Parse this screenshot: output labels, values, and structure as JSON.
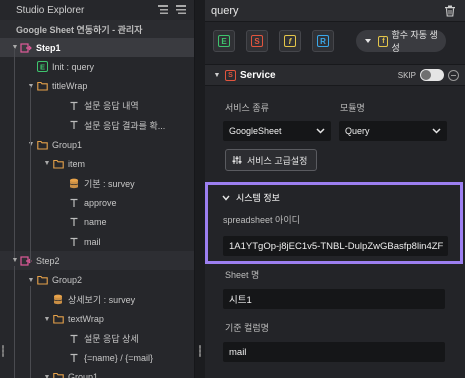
{
  "explorer": {
    "title": "Studio Explorer",
    "subtitle": "Google Sheet 연동하기 - 관리자",
    "tree": [
      {
        "label": "Step1",
        "icon": "step-icon",
        "level": 0,
        "caret": "▼",
        "selected": true
      },
      {
        "label": "Init : query",
        "icon": "init-e-icon",
        "level": 1,
        "caret": ""
      },
      {
        "label": "titleWrap",
        "icon": "folder-icon",
        "level": 1,
        "caret": "▼"
      },
      {
        "label": "설문 응답 내역",
        "icon": "text-icon",
        "level": 3,
        "caret": ""
      },
      {
        "label": "설문 응답 결과를 확...",
        "icon": "text-icon",
        "level": 3,
        "caret": ""
      },
      {
        "label": "Group1",
        "icon": "folder-icon",
        "level": 1,
        "caret": "▼"
      },
      {
        "label": "item",
        "icon": "folder-icon",
        "level": 2,
        "caret": "▼"
      },
      {
        "label": "기본 : survey",
        "icon": "database-icon",
        "level": 3,
        "caret": ""
      },
      {
        "label": "approve",
        "icon": "text-icon",
        "level": 3,
        "caret": ""
      },
      {
        "label": "name",
        "icon": "text-icon",
        "level": 3,
        "caret": ""
      },
      {
        "label": "mail",
        "icon": "text-icon",
        "level": 3,
        "caret": ""
      },
      {
        "label": "Step2",
        "icon": "step-icon",
        "level": 0,
        "caret": "▼",
        "alt": true
      },
      {
        "label": "Group2",
        "icon": "folder-icon",
        "level": 1,
        "caret": "▼"
      },
      {
        "label": "상세보기 : survey",
        "icon": "database-icon",
        "level": 2,
        "caret": ""
      },
      {
        "label": "textWrap",
        "icon": "folder-icon",
        "level": 2,
        "caret": "▼"
      },
      {
        "label": "설문 응답 상세",
        "icon": "text-icon",
        "level": 3,
        "caret": ""
      },
      {
        "label": "{=name} / {=mail}",
        "icon": "text-icon",
        "level": 3,
        "caret": ""
      },
      {
        "label": "Group1",
        "icon": "folder-icon",
        "level": 2,
        "caret": "▼"
      }
    ]
  },
  "panel": {
    "query_name": "query",
    "toolbar": {
      "buttons": [
        {
          "name": "e-type-icon",
          "letter": "E",
          "color": "#3ec46d"
        },
        {
          "name": "s-type-icon",
          "letter": "S",
          "color": "#e2553e"
        },
        {
          "name": "f-type-icon",
          "letter": "f",
          "color": "#e4c64a"
        },
        {
          "name": "r-type-icon",
          "letter": "R",
          "color": "#3aa7e8"
        }
      ],
      "function_button_label": "함수 자동 생성"
    },
    "service": {
      "label": "Service",
      "skip_label": "SKIP",
      "service_type_label": "서비스 종류",
      "service_type_value": "GoogleSheet",
      "module_label": "모듈명",
      "module_value": "Query",
      "advanced_button_label": "서비스 고급설정"
    },
    "system": {
      "title": "시스템 정보",
      "spreadsheet_label": "spreadsheet 아이디",
      "spreadsheet_value": "1A1YTgOp-j8jEC1v5-TNBL-DulpZwGBasfp8lin4ZF",
      "sheet_label": "Sheet 명",
      "sheet_value": "시트1",
      "column_label": "기준 컬럼명",
      "column_value": "mail"
    }
  },
  "colors": {
    "accent_purple": "#9c7ff0",
    "step_pink": "#e05a9a",
    "folder_orange": "#e7a24a",
    "service_red": "#e2553e",
    "db_orange": "#e7a24a"
  }
}
